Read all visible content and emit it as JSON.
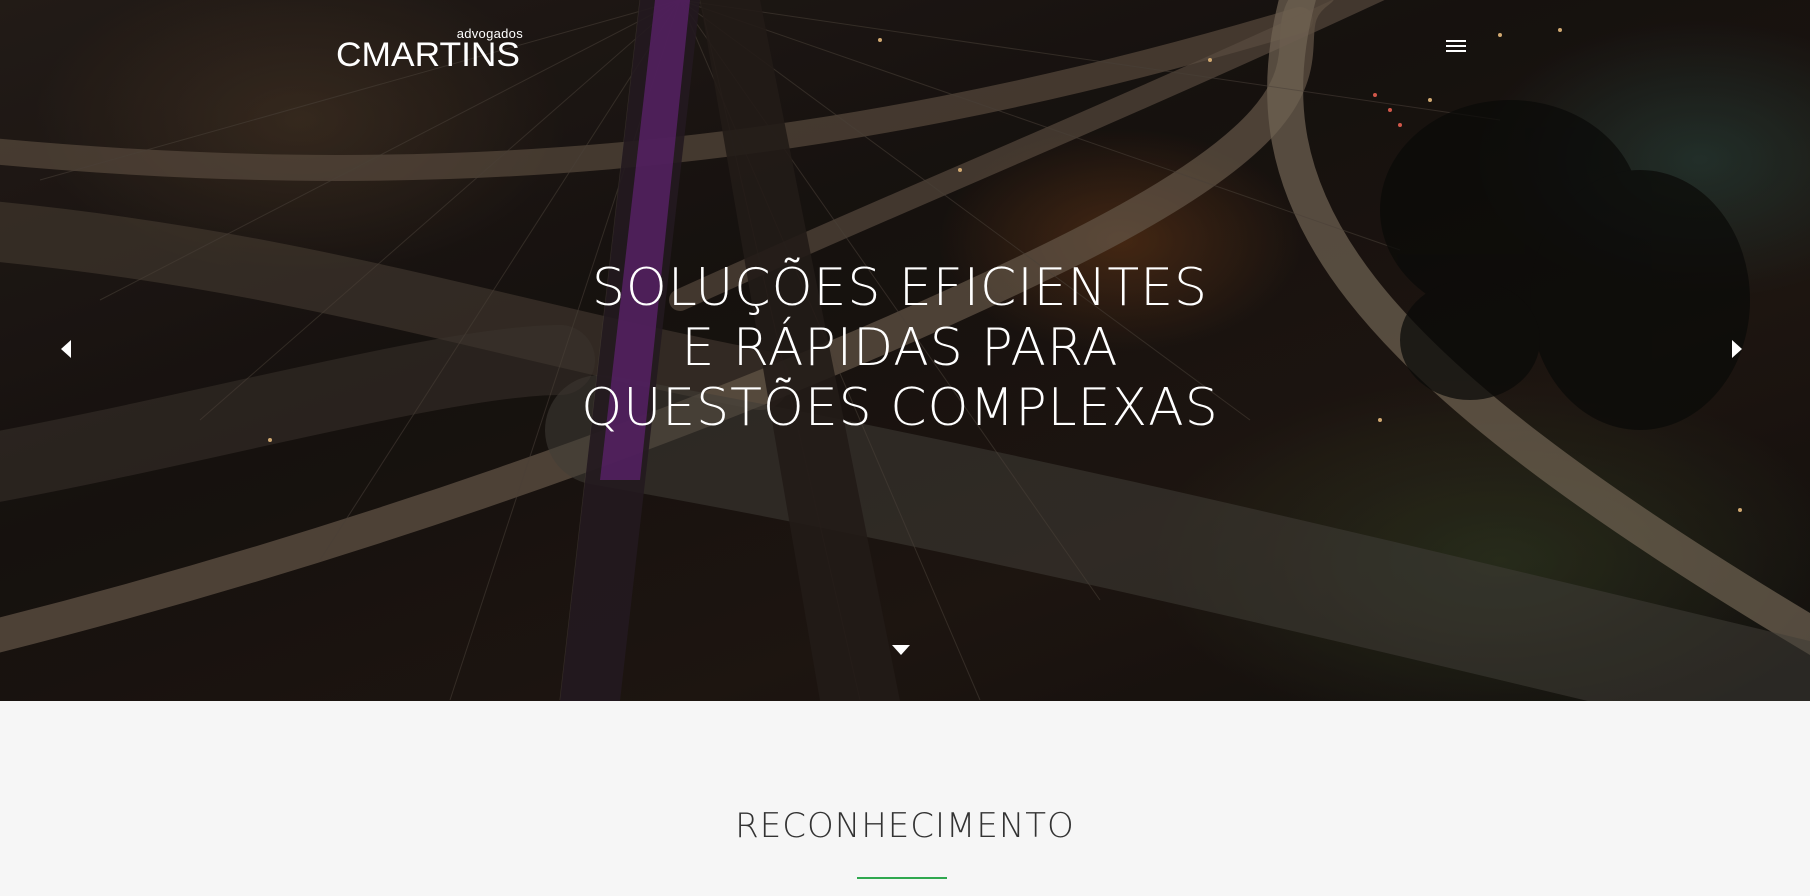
{
  "header": {
    "logo_small": "advogados",
    "logo_big": "CMARTINS",
    "menu_icon": "hamburger-menu-icon"
  },
  "hero": {
    "headline_lines": [
      "SOLUÇÕES EFICIENTES",
      "E RÁPIDAS PARA",
      "QUESTÕES COMPLEXAS"
    ],
    "prev_icon": "chevron-left-icon",
    "next_icon": "chevron-right-icon",
    "scroll_icon": "chevron-down-icon"
  },
  "section": {
    "title": "RECONHECIMENTO",
    "accent_color": "#2fa84f"
  }
}
